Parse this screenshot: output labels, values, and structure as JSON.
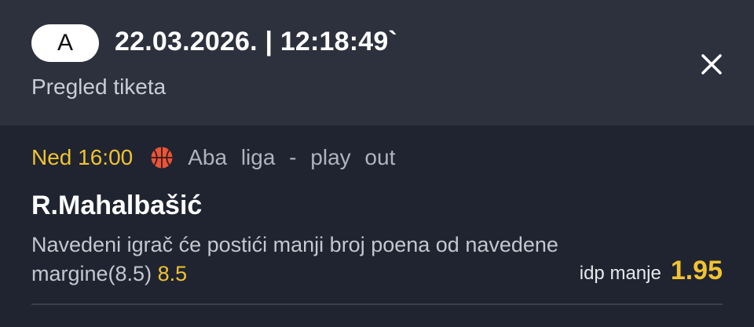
{
  "header": {
    "badge": "A",
    "datetime": "22.03.2026. | 12:18:49`",
    "subtitle": "Pregled tiketa",
    "close_icon": "close-icon"
  },
  "ticket": {
    "time": "Ned 16:00",
    "sport_icon": "basketball-icon",
    "league": "Aba liga - play out",
    "player": "R.Mahalbašić",
    "description": "Navedeni igrač će postići manji broj poena od navedene margine(8.5)",
    "margin": "8.5",
    "odds_label": "idp manje",
    "odds_value": "1.95"
  },
  "colors": {
    "accent": "#f1c232",
    "header_bg": "#2c313d",
    "content_bg": "#1f2430"
  }
}
